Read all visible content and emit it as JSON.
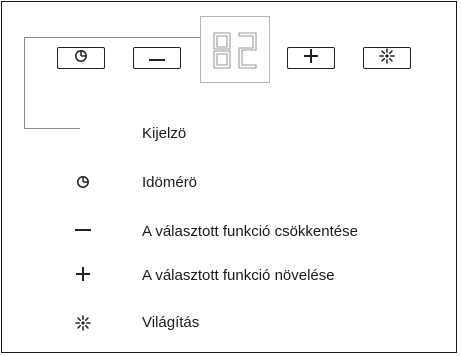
{
  "panel": {
    "display_value": "02",
    "buttons": [
      {
        "id": "timer",
        "icon": "timer-icon"
      },
      {
        "id": "minus",
        "icon": "minus-icon"
      },
      {
        "id": "plus",
        "icon": "plus-icon"
      },
      {
        "id": "light",
        "icon": "light-icon"
      }
    ]
  },
  "legend": [
    {
      "icon": "none",
      "label": "Kijelzö"
    },
    {
      "icon": "timer-icon",
      "label": "Idömérö"
    },
    {
      "icon": "minus-icon",
      "label": "A választott funkció csökkentése"
    },
    {
      "icon": "plus-icon",
      "label": "A választott funkció növelése"
    },
    {
      "icon": "light-icon",
      "label": "Világítás"
    }
  ]
}
